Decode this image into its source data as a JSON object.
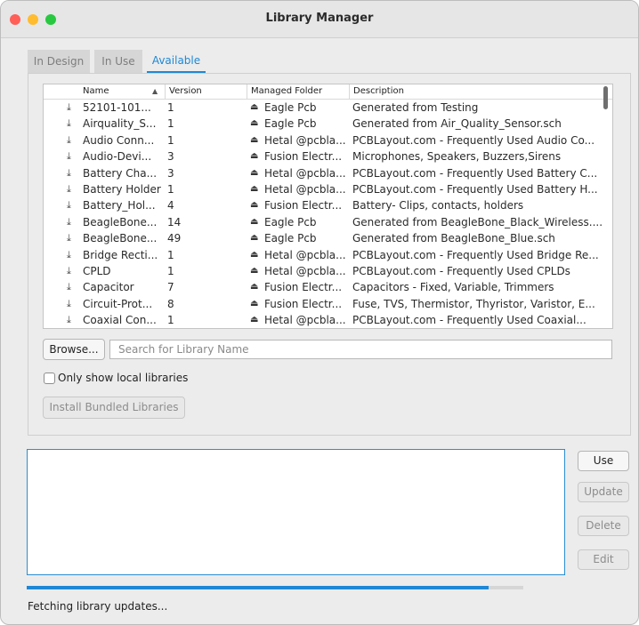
{
  "window": {
    "title": "Library Manager",
    "controls": [
      {
        "name": "close",
        "color": "#ff5f57"
      },
      {
        "name": "minimize",
        "color": "#febc2e"
      },
      {
        "name": "zoom",
        "color": "#28c840"
      }
    ]
  },
  "tabs": [
    {
      "label": "In Design",
      "active": false
    },
    {
      "label": "In Use",
      "active": false
    },
    {
      "label": "Available",
      "active": true
    }
  ],
  "table": {
    "columns": [
      "Name",
      "Version",
      "Managed Folder",
      "Description"
    ],
    "sort_indicator": "▲",
    "rows": [
      {
        "name": "52101-101...",
        "version": "1",
        "folder": "Eagle Pcb",
        "description": "Generated from Testing"
      },
      {
        "name": "Airquality_S...",
        "version": "1",
        "folder": "Eagle Pcb",
        "description": "Generated from Air_Quality_Sensor.sch"
      },
      {
        "name": "Audio Conn...",
        "version": "1",
        "folder": "Hetal @pcbla...",
        "description": "PCBLayout.com - Frequently Used Audio Co..."
      },
      {
        "name": "Audio-Devi...",
        "version": "3",
        "folder": "Fusion Electr...",
        "description": "Microphones, Speakers, Buzzers,Sirens"
      },
      {
        "name": "Battery Cha...",
        "version": "3",
        "folder": "Hetal @pcbla...",
        "description": "PCBLayout.com - Frequently Used Battery C..."
      },
      {
        "name": "Battery Holder",
        "version": "1",
        "folder": "Hetal @pcbla...",
        "description": "PCBLayout.com - Frequently Used Battery H..."
      },
      {
        "name": "Battery_Hol...",
        "version": "4",
        "folder": "Fusion Electr...",
        "description": "Battery- Clips, contacts, holders"
      },
      {
        "name": "BeagleBone...",
        "version": "14",
        "folder": "Eagle Pcb",
        "description": "Generated from BeagleBone_Black_Wireless...."
      },
      {
        "name": "BeagleBone...",
        "version": "49",
        "folder": "Eagle Pcb",
        "description": "Generated from BeagleBone_Blue.sch"
      },
      {
        "name": "Bridge Recti...",
        "version": "1",
        "folder": "Hetal @pcbla...",
        "description": "PCBLayout.com - Frequently Used Bridge Re..."
      },
      {
        "name": "CPLD",
        "version": "1",
        "folder": "Hetal @pcbla...",
        "description": "PCBLayout.com - Frequently Used CPLDs"
      },
      {
        "name": "Capacitor",
        "version": "7",
        "folder": "Fusion Electr...",
        "description": "Capacitors - Fixed, Variable, Trimmers"
      },
      {
        "name": "Circuit-Prot...",
        "version": "8",
        "folder": "Fusion Electr...",
        "description": "Fuse, TVS, Thermistor, Thyristor, Varistor, E..."
      },
      {
        "name": "Coaxial Con...",
        "version": "1",
        "folder": "Hetal @pcbla...",
        "description": "PCBLayout.com - Frequently Used  Coaxial..."
      }
    ]
  },
  "browse_label": "Browse...",
  "search_placeholder": "Search for Library Name",
  "only_local_label": "Only show local libraries",
  "install_bundled_label": "Install Bundled Libraries",
  "side_buttons": {
    "use": "Use",
    "update": "Update",
    "delete": "Delete",
    "edit": "Edit"
  },
  "progress": {
    "fraction": 0.93
  },
  "status_text": "Fetching library updates..."
}
